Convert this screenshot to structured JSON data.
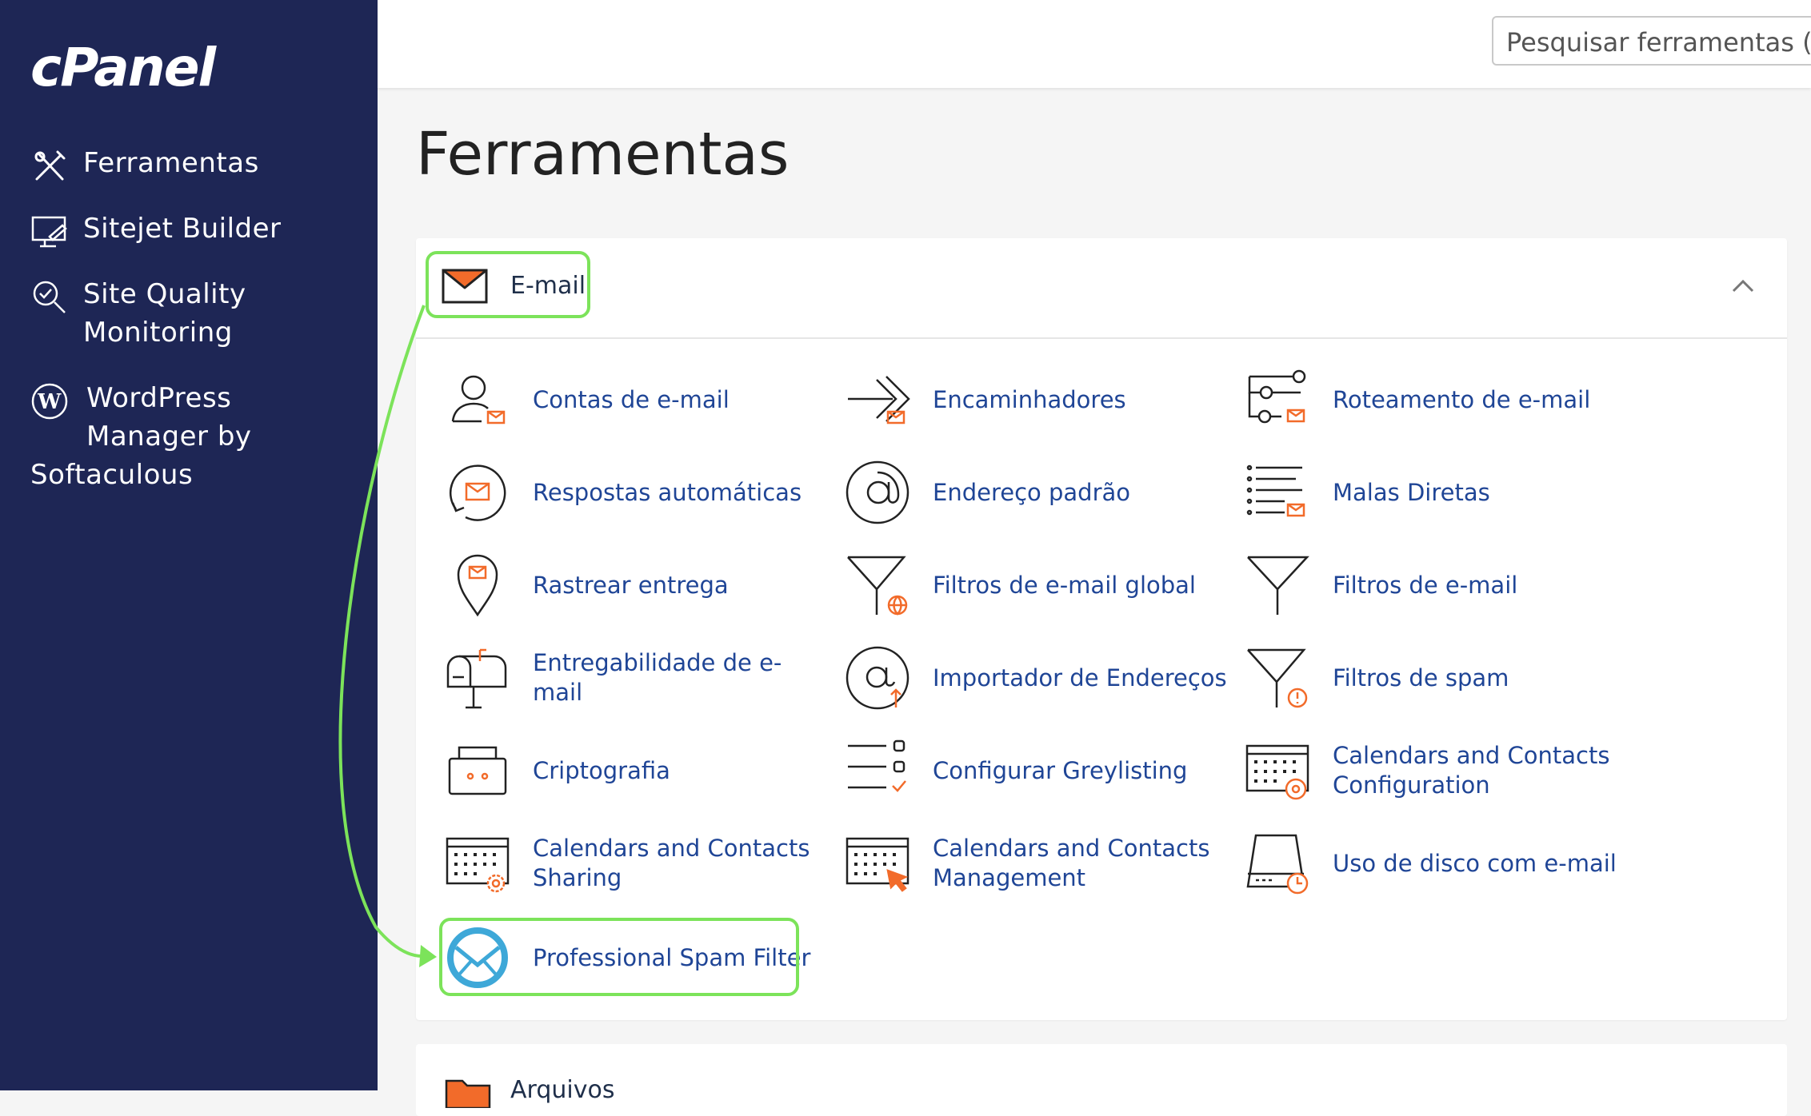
{
  "app": {
    "logo_text": "cPanel"
  },
  "sidebar": {
    "items": [
      {
        "label": "Ferramentas",
        "icon": "tools-icon"
      },
      {
        "label": "Sitejet Builder",
        "icon": "monitor-edit-icon"
      },
      {
        "label": "Site Quality Monitoring",
        "line1": "Site Quality",
        "line2": "Monitoring",
        "icon": "magnifier-check-icon"
      },
      {
        "label": "WordPress Manager by Softaculous",
        "line1": "WordPress",
        "line2": "Manager by",
        "line3": "Softaculous",
        "icon": "wordpress-icon"
      }
    ]
  },
  "search": {
    "placeholder": "Pesquisar ferramentas (/)"
  },
  "page": {
    "title": "Ferramentas"
  },
  "email_section": {
    "title": "E-mail",
    "tools": [
      {
        "label": "Contas de e-mail",
        "icon": "user-mail-icon"
      },
      {
        "label": "Encaminhadores",
        "icon": "forward-icon"
      },
      {
        "label": "Roteamento de e-mail",
        "icon": "routing-icon"
      },
      {
        "label": "Respostas automáticas",
        "icon": "autoresponder-icon"
      },
      {
        "label": "Endereço padrão",
        "icon": "at-icon"
      },
      {
        "label": "Malas Diretas",
        "icon": "list-mail-icon"
      },
      {
        "label": "Rastrear entrega",
        "icon": "pin-mail-icon"
      },
      {
        "label": "Filtros de e-mail global",
        "icon": "filter-globe-icon"
      },
      {
        "label": "Filtros de e-mail",
        "icon": "filter-icon"
      },
      {
        "label": "Entregabilidade de e-mail",
        "icon": "mailbox-icon"
      },
      {
        "label": "Importador de Endereços",
        "icon": "at-upload-icon"
      },
      {
        "label": "Filtros de spam",
        "icon": "filter-alert-icon"
      },
      {
        "label": "Criptografia",
        "icon": "briefcase-icon"
      },
      {
        "label": "Configurar Greylisting",
        "icon": "checklist-icon"
      },
      {
        "label": "Calendars and Contacts Configuration",
        "line1": "Calendars and Contacts",
        "line2": "Configuration",
        "icon": "calendar-at-icon"
      },
      {
        "label": "Calendars and Contacts Sharing",
        "line1": "Calendars and Contacts",
        "line2": "Sharing",
        "icon": "calendar-gear-icon"
      },
      {
        "label": "Calendars and Contacts Management",
        "line1": "Calendars and Contacts",
        "line2": "Management",
        "icon": "calendar-cursor-icon"
      },
      {
        "label": "Uso de disco com e-mail",
        "icon": "disk-clock-icon"
      },
      {
        "label": "Professional Spam Filter",
        "icon": "spam-filter-logo-icon"
      }
    ]
  },
  "next_section": {
    "title": "Arquivos"
  },
  "colors": {
    "sidebar": "#1e2655",
    "accent": "#f26b2a",
    "link": "#1f4596",
    "highlight": "#7ce35a"
  }
}
